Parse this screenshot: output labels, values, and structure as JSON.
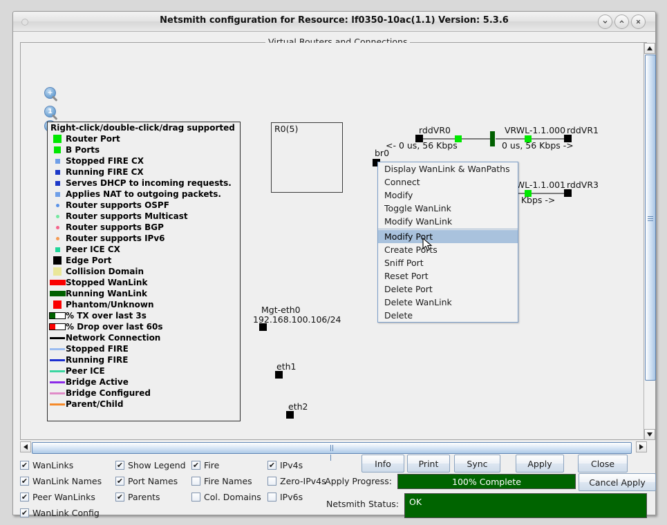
{
  "window": {
    "title": "Netsmith configuration for Resource:  lf0350-10ac(1.1)  Version: 5.3.6",
    "minimize_icon": "chevron-down",
    "maximize_icon": "chevron-up",
    "close_icon": "close-x"
  },
  "canvas": {
    "group_title": "Virtual Routers and Connections",
    "zoom_in_glyph": "+",
    "zoom_reset_glyph": "1",
    "zoom_out_glyph": "−"
  },
  "legend": {
    "items": [
      {
        "label": "Right-click/double-click/drag supported",
        "swatch": "none",
        "color": ""
      },
      {
        "label": "Router Port",
        "swatch": "square",
        "color": "#00e800"
      },
      {
        "label": "B Ports",
        "swatch": "square-sm",
        "color": "#00e800"
      },
      {
        "label": "Stopped FIRE CX",
        "swatch": "square-xs",
        "color": "#6f9fe8"
      },
      {
        "label": "Running FIRE CX",
        "swatch": "square-xs",
        "color": "#1c38c8"
      },
      {
        "label": "Serves DHCP to incoming requests.",
        "swatch": "square-xs",
        "color": "#1c38c8"
      },
      {
        "label": "Applies NAT to outgoing packets.",
        "swatch": "square-xs",
        "color": "#6f9fe8"
      },
      {
        "label": "Router supports OSPF",
        "swatch": "dot",
        "color": "#5b93e8"
      },
      {
        "label": "Router supports Multicast",
        "swatch": "dot",
        "color": "#74e8a0"
      },
      {
        "label": "Router supports BGP",
        "swatch": "dot",
        "color": "#f5648c"
      },
      {
        "label": "Router supports IPv6",
        "swatch": "dot",
        "color": "#f59a52"
      },
      {
        "label": "Peer ICE CX",
        "swatch": "square-xs",
        "color": "#1ed69a"
      },
      {
        "label": "Edge Port",
        "swatch": "square",
        "color": "#000000"
      },
      {
        "label": "Collision Domain",
        "swatch": "square",
        "color": "#eae79a"
      },
      {
        "label": "Stopped WanLink",
        "swatch": "bar",
        "color": "#fa0000"
      },
      {
        "label": "Running WanLink",
        "swatch": "bar",
        "color": "#006000"
      },
      {
        "label": "Phantom/Unknown",
        "swatch": "square",
        "color": "#fa0000"
      },
      {
        "label": "% TX over last 3s",
        "swatch": "meter",
        "color": "#006000"
      },
      {
        "label": "% Drop over last 60s",
        "swatch": "meter",
        "color": "#fa0000"
      },
      {
        "label": "Network Connection",
        "swatch": "line",
        "color": "#000000"
      },
      {
        "label": "Stopped FIRE",
        "swatch": "line",
        "color": "#9bbcf0"
      },
      {
        "label": "Running FIRE",
        "swatch": "line",
        "color": "#1c2fd0"
      },
      {
        "label": "Peer ICE",
        "swatch": "line",
        "color": "#3ad6a0"
      },
      {
        "label": "Bridge Active",
        "swatch": "line",
        "color": "#8c2ae8"
      },
      {
        "label": "Bridge Configured",
        "swatch": "line",
        "color": "#e08cc8"
      },
      {
        "label": "Parent/Child",
        "swatch": "line",
        "color": "#f58a2a"
      }
    ]
  },
  "diagram": {
    "router_box_label": "R0(5)",
    "nodes": [
      {
        "name": "br0"
      },
      {
        "name": "Mgt-eth0"
      },
      {
        "name": "192.168.100.106/24"
      },
      {
        "name": "eth1"
      },
      {
        "name": "eth2"
      }
    ],
    "links": [
      {
        "left_endpoint": "rddVR0",
        "right_endpoint": "rddVR1",
        "wanlink_name": "VRWL-1.1.000",
        "left_rate": "<- 0 us, 56 Kbps",
        "right_rate": "0 us, 56 Kbps ->"
      },
      {
        "right_endpoint": "rddVR3",
        "wanlink_name": "VRWL-1.1.001",
        "right_rate": ", 56 Kbps ->"
      }
    ]
  },
  "context_menu": {
    "items": [
      {
        "label": "Display WanLink & WanPaths",
        "selected": false
      },
      {
        "label": "Connect",
        "selected": false
      },
      {
        "label": "Modify",
        "selected": false
      },
      {
        "label": "Toggle WanLink",
        "selected": false
      },
      {
        "label": "Modify WanLink",
        "selected": false
      },
      {
        "label": "Modify Port",
        "selected": true
      },
      {
        "label": "Create Ports",
        "selected": false
      },
      {
        "label": "Sniff Port",
        "selected": false
      },
      {
        "label": "Reset Port",
        "selected": false
      },
      {
        "label": "Delete Port",
        "selected": false
      },
      {
        "label": "Delete WanLink",
        "selected": false
      },
      {
        "label": "Delete",
        "selected": false
      }
    ]
  },
  "options": {
    "col1": [
      {
        "label": "WanLinks",
        "checked": true
      },
      {
        "label": "WanLink Names",
        "checked": true
      },
      {
        "label": "Peer WanLinks",
        "checked": true
      },
      {
        "label": "WanLink Config",
        "checked": true
      }
    ],
    "col2": [
      {
        "label": "Show Legend",
        "checked": true
      },
      {
        "label": "Port Names",
        "checked": true
      },
      {
        "label": "Parents",
        "checked": true
      }
    ],
    "col3": [
      {
        "label": "Fire",
        "checked": true
      },
      {
        "label": "Fire Names",
        "checked": false
      },
      {
        "label": "Col. Domains",
        "checked": false
      }
    ],
    "col4": [
      {
        "label": "IPv4s",
        "checked": true
      },
      {
        "label": "Zero-IPv4s",
        "checked": false
      },
      {
        "label": "IPv6s",
        "checked": false
      }
    ],
    "check_glyph": "✔"
  },
  "buttons": {
    "info": "Info",
    "print": "Print",
    "sync": "Sync",
    "apply": "Apply",
    "close": "Close",
    "cancel_apply": "Cancel Apply"
  },
  "status": {
    "progress_label": "Apply Progress:",
    "progress_value": "100% Complete",
    "netsmith_label": "Netsmith Status:",
    "netsmith_value": "OK",
    "progress_color": "#006400"
  }
}
